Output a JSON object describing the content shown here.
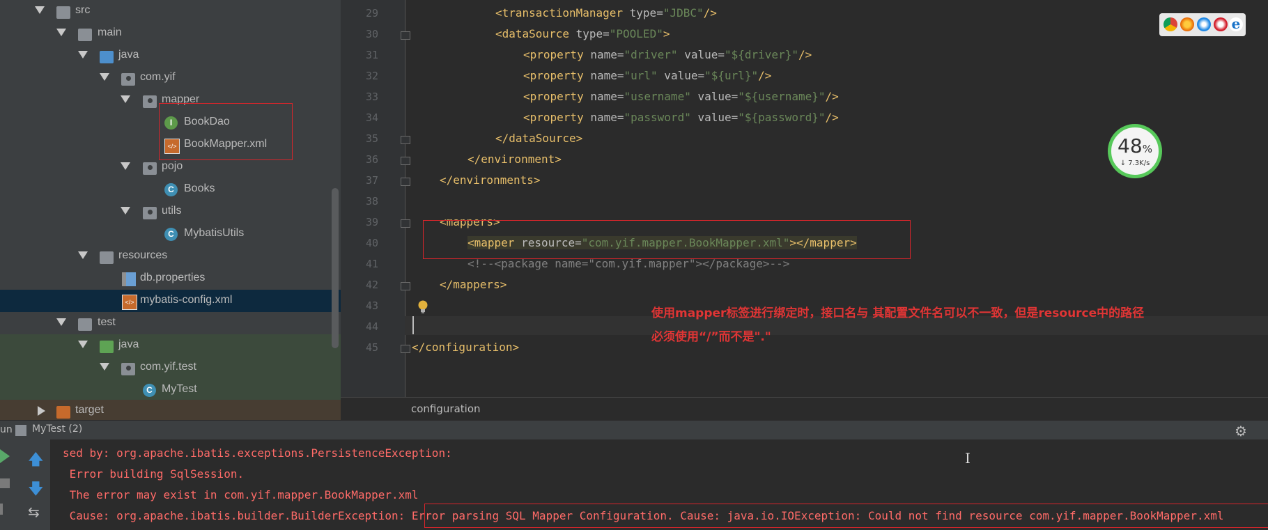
{
  "tree": {
    "items": [
      {
        "label": "src",
        "kind": "folder-grey",
        "arrow": "down"
      },
      {
        "label": "main",
        "kind": "folder-grey",
        "arrow": "down"
      },
      {
        "label": "java",
        "kind": "folder-blue",
        "arrow": "down"
      },
      {
        "label": "com.yif",
        "kind": "package",
        "arrow": "down"
      },
      {
        "label": "mapper",
        "kind": "package",
        "arrow": "down"
      },
      {
        "label": "BookDao",
        "kind": "interface",
        "icon_letter": "I"
      },
      {
        "label": "BookMapper.xml",
        "kind": "xml"
      },
      {
        "label": "pojo",
        "kind": "package",
        "arrow": "down"
      },
      {
        "label": "Books",
        "kind": "class",
        "icon_letter": "C"
      },
      {
        "label": "utils",
        "kind": "package",
        "arrow": "down"
      },
      {
        "label": "MybatisUtils",
        "kind": "class",
        "icon_letter": "C"
      },
      {
        "label": "resources",
        "kind": "resources",
        "arrow": "down"
      },
      {
        "label": "db.properties",
        "kind": "properties"
      },
      {
        "label": "mybatis-config.xml",
        "kind": "xml",
        "selected": true
      },
      {
        "label": "test",
        "kind": "folder-grey",
        "arrow": "down"
      },
      {
        "label": "java",
        "kind": "folder-green",
        "arrow": "down"
      },
      {
        "label": "com.yif.test",
        "kind": "package",
        "arrow": "down"
      },
      {
        "label": "MyTest",
        "kind": "class",
        "icon_letter": "C"
      },
      {
        "label": "target",
        "kind": "folder-orange",
        "arrow": "right"
      }
    ]
  },
  "editor": {
    "line_numbers": [
      "29",
      "30",
      "31",
      "32",
      "33",
      "34",
      "35",
      "36",
      "37",
      "38",
      "39",
      "40",
      "41",
      "42",
      "43",
      "44",
      "45"
    ],
    "lines": [
      {
        "t1": "<transactionManager ",
        "a1": "type=",
        "v1": "\"JDBC\"",
        "t2": "/>"
      },
      {
        "t1": "<dataSource ",
        "a1": "type=",
        "v1": "\"POOLED\"",
        "t2": ">"
      },
      {
        "t1": "<property ",
        "a1": "name=",
        "v1": "\"driver\"",
        "a2": " value=",
        "v2": "\"${driver}\"",
        "t2": "/>"
      },
      {
        "t1": "<property ",
        "a1": "name=",
        "v1": "\"url\"",
        "a2": " value=",
        "v2": "\"${url}\"",
        "t2": "/>"
      },
      {
        "t1": "<property ",
        "a1": "name=",
        "v1": "\"username\"",
        "a2": " value=",
        "v2": "\"${username}\"",
        "t2": "/>"
      },
      {
        "t1": "<property ",
        "a1": "name=",
        "v1": "\"password\"",
        "a2": " value=",
        "v2": "\"${password}\"",
        "t2": "/>"
      },
      {
        "t1": "</dataSource>"
      },
      {
        "t1": "</environment>"
      },
      {
        "t1": "</environments>"
      },
      {
        "t1": ""
      },
      {
        "t1": "<mappers>"
      },
      {
        "t1": "<mapper ",
        "a1": "resource=",
        "v1": "\"com.yif.mapper.BookMapper.xml\"",
        "t2": "></mapper>"
      },
      {
        "cmt": "<!--<package name=\"com.yif.mapper\"></package>-->"
      },
      {
        "t1": "</mappers>"
      },
      {
        "t1": ""
      },
      {
        "t1": ""
      },
      {
        "t1": "</configuration>"
      }
    ],
    "annotation_line1": "使用mapper标签进行绑定时，接口名与 其配置文件名可以不一致，但是resource中的路径",
    "annotation_line2": "必须使用“/”而不是\".\"",
    "breadcrumb": "configuration",
    "speed_percent": "48",
    "speed_percent_unit": "%",
    "speed_rate": "↓ 7.3K/s"
  },
  "run": {
    "title": "un",
    "tab_label": "MyTest (2)",
    "console_lines": [
      "sed by: org.apache.ibatis.exceptions.PersistenceException:",
      " Error building SqlSession.",
      " The error may exist in com.yif.mapper.BookMapper.xml",
      " Cause: org.apache.ibatis.builder.BuilderException: Error parsing SQL Mapper Configuration. Cause: java.io.IOException: Could not find resource com.yif.mapper.BookMapper.xml"
    ]
  },
  "colors": {
    "tag": "#e8bf6a",
    "attr": "#bababa",
    "value": "#6a8759",
    "error": "#ff6b68",
    "annotation": "#e03535",
    "highlight_box": "#d9252b"
  }
}
